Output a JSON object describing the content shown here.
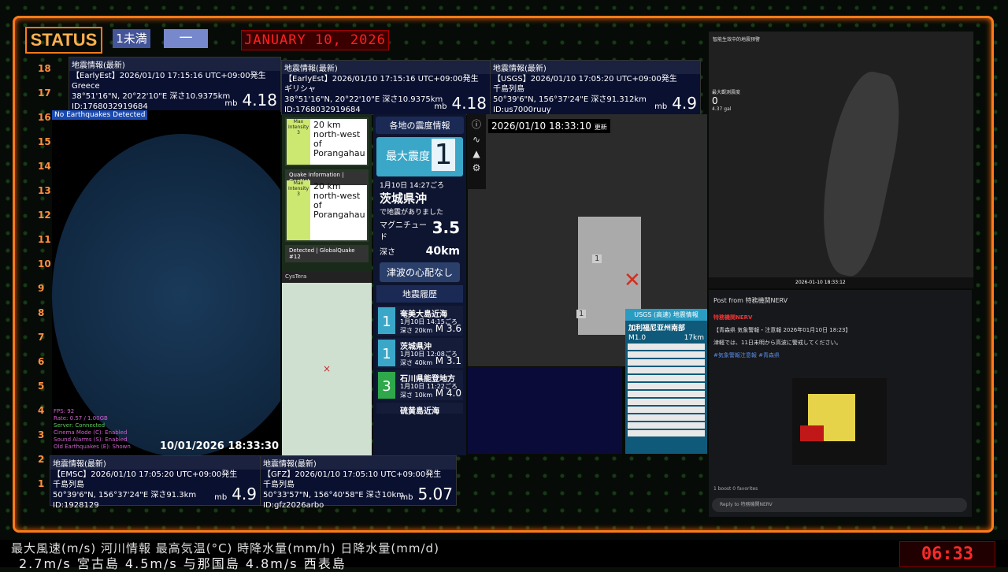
{
  "header": {
    "status": "STATUS",
    "badge1": "1未満",
    "badge2": "一",
    "date": "JANUARY 10, 2026"
  },
  "ruler": [
    "18",
    "17",
    "16",
    "15",
    "14",
    "13",
    "12",
    "11",
    "10",
    "9",
    "8",
    "7",
    "6",
    "5",
    "4",
    "3",
    "2",
    "1"
  ],
  "eq_panels": [
    {
      "title": "地震情報(最新)",
      "line1": "【EarlyEst】2026/01/10  17:15:16  UTC+09:00発生",
      "line2": "Greece",
      "line3": "38°51'16\"N, 20°22'10\"E  深さ10.9375km",
      "line4": "ID:1768032919684",
      "mb": "mb",
      "mag": "4.18"
    },
    {
      "title": "地震情報(最新)",
      "line1": "【EarlyEst】2026/01/10  17:15:16  UTC+09:00発生",
      "line2": "ギリシャ",
      "line3": "38°51'16\"N, 20°22'10\"E  深さ10.9375km",
      "line4": "ID:1768032919684",
      "mb": "mb",
      "mag": "4.18"
    },
    {
      "title": "地震情報(最新)",
      "line1": "【USGS】2026/01/10  17:05:20  UTC+09:00発生",
      "line2": "千島列島",
      "line3": "50°39'6\"N, 156°37'24\"E  深さ91.312km",
      "line4": "ID:us7000ruuy",
      "mb": "mb",
      "mag": "4.9"
    },
    {
      "title": "地震情報(最新)",
      "line1": "【EMSC】2026/01/10  17:05:20  UTC+09:00発生",
      "line2": "千島列島",
      "line3": "50°39'6\"N, 156°37'24\"E  深さ91.3km",
      "line4": "ID:1928129",
      "mb": "mb",
      "mag": "4.9"
    },
    {
      "title": "地震情報(最新)",
      "line1": "【GFZ】2026/01/10  17:05:10  UTC+09:00発生",
      "line2": "千島列島",
      "line3": "50°33'57\"N, 156°40'58\"E  深さ10km",
      "line4": "ID:gfz2026arbo",
      "mb": "mb",
      "mag": "5.07"
    }
  ],
  "globe": {
    "title": "No Earthquakes Detected",
    "fps": "FPS: 92",
    "rate": "Rate: 0.57 / 1.00GB",
    "server": "Server: Connected",
    "cinema": "Cinema Mode (C): Enabled",
    "sound": "Sound Alarms (S): Enabled",
    "old": "Old Earthquakes (E): Shown",
    "time": "10/01/2026 18:33:30"
  },
  "geonet": {
    "card1_big": "20 km north-west of Porangahau",
    "card1_side": "Max Intensity 3",
    "card2_head": "Quake information | GeoNet",
    "card2_big": "20 km north-west of Porangahau",
    "card2_side": "Max Intensity 3",
    "card3_head": "Detected | GlobalQuake  #12"
  },
  "cysta": {
    "title": "CysTera"
  },
  "shindo": {
    "header": "各地の震度情報",
    "max_label": "最大震度",
    "max_value": "1",
    "time": "1月10日 14:27ごろ",
    "place": "茨城県沖",
    "note": "で地震がありました",
    "mag_label": "マグニチュード",
    "mag_value": "3.5",
    "depth_label": "深さ",
    "depth_value": "40km",
    "tsunami": "津波の心配なし",
    "history_header": "地震履歴",
    "history": [
      {
        "int": "1",
        "place": "奄美大島近海",
        "time": "1月10日 14:15ごろ",
        "depth": "深さ 20km",
        "mag": "M 3.6"
      },
      {
        "int": "1",
        "place": "茨城県沖",
        "time": "1月10日 12:08ごろ",
        "depth": "深さ 40km",
        "mag": "M 3.1"
      },
      {
        "int": "3",
        "place": "石川県能登地方",
        "time": "1月10日 11:22ごろ",
        "depth": "深さ 10km",
        "mag": "M 4.0"
      },
      {
        "int": "",
        "place": "硫黄島近海",
        "time": "",
        "depth": "",
        "mag": ""
      }
    ]
  },
  "jmap": {
    "time": "2026/01/10  18:33:10",
    "updated": "更新",
    "marker1": "1",
    "marker2": "1"
  },
  "usgs": {
    "title": "USGS (高速) 地震情報",
    "place": "加利福尼亚州南部",
    "mag": "M1.0",
    "depth": "17km"
  },
  "taiwan": {
    "title": "智能生效中的地震预警",
    "max": "最大觀測震度",
    "zero": "0",
    "pga": "4.37 gal",
    "date": "2026-01-10 18:33:12"
  },
  "nerv": {
    "header": "Post from 特務機関NERV",
    "name": "特務機関NERV",
    "line1": "【青森県 気象警報・注意報 2026年01月10日 18:23】",
    "line2": "津軽では、11日未明から高波に警戒してください。",
    "line3": "#気象警報注意報 #青森県",
    "reply": "Reply to 特務機関NERV",
    "footer": "1 boost  0 favorites"
  },
  "ticker": {
    "row1": "最大風速(m/s)  河川情報      最高気温(°C)    時降水量(mm/h)  日降水量(mm/d)",
    "row2": "2.7m/s     宮古島 4.5m/s     与那国島 4.8m/s      西表島"
  },
  "clock": "06:33"
}
